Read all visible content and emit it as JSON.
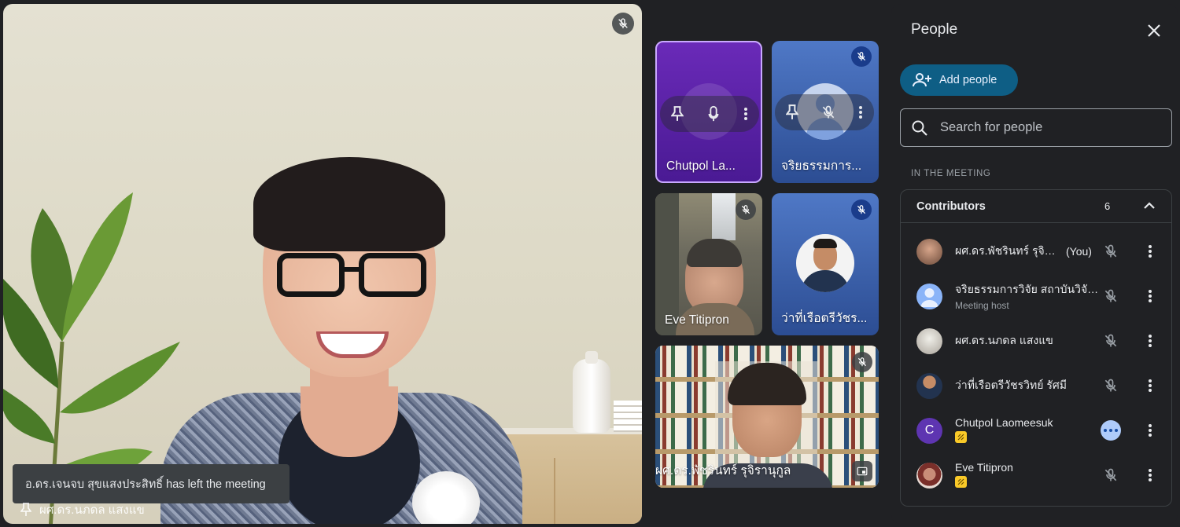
{
  "main_tile": {
    "toast": "อ.ดร.เจนจบ สุขแสงประสิทธิ์ has left the meeting",
    "name": "ผศ.ดร.นภดล แสงแข"
  },
  "tiles": [
    {
      "name": "Chutpol La..."
    },
    {
      "name": "จริยธรรมการ..."
    },
    {
      "name": "Eve Titipron"
    },
    {
      "name": "ว่าที่เรือตรีวัชร..."
    },
    {
      "name": "ผศ.ดร.พัชรินทร์ รุจิรานุกูล"
    }
  ],
  "panel": {
    "title": "People",
    "add_label": "Add people",
    "search_placeholder": "Search for people",
    "section_label": "IN THE MEETING",
    "contributors_label": "Contributors",
    "contributors_count": "6",
    "participants": [
      {
        "name": "ผศ.ดร.พัชรินทร์ รุจิรา...",
        "tag": "(You)",
        "sub": ""
      },
      {
        "name": "จริยธรรมการวิจัย สถาบันวิจัย...",
        "tag": "",
        "sub": "Meeting host"
      },
      {
        "name": "ผศ.ดร.นภดล แสงแข",
        "tag": "",
        "sub": ""
      },
      {
        "name": "ว่าที่เรือตรีวัชรวิทย์ รัศมี",
        "tag": "",
        "sub": ""
      },
      {
        "name": "Chutpol Laomeesuk",
        "tag": "",
        "sub": "",
        "initial": "C"
      },
      {
        "name": "Eve Titipron",
        "tag": "",
        "sub": ""
      }
    ]
  },
  "colors": {
    "background": "#202124",
    "accent_button": "#0e5e85",
    "avatar_purple": "#5e35b1",
    "badge_yellow": "#f9c928"
  }
}
